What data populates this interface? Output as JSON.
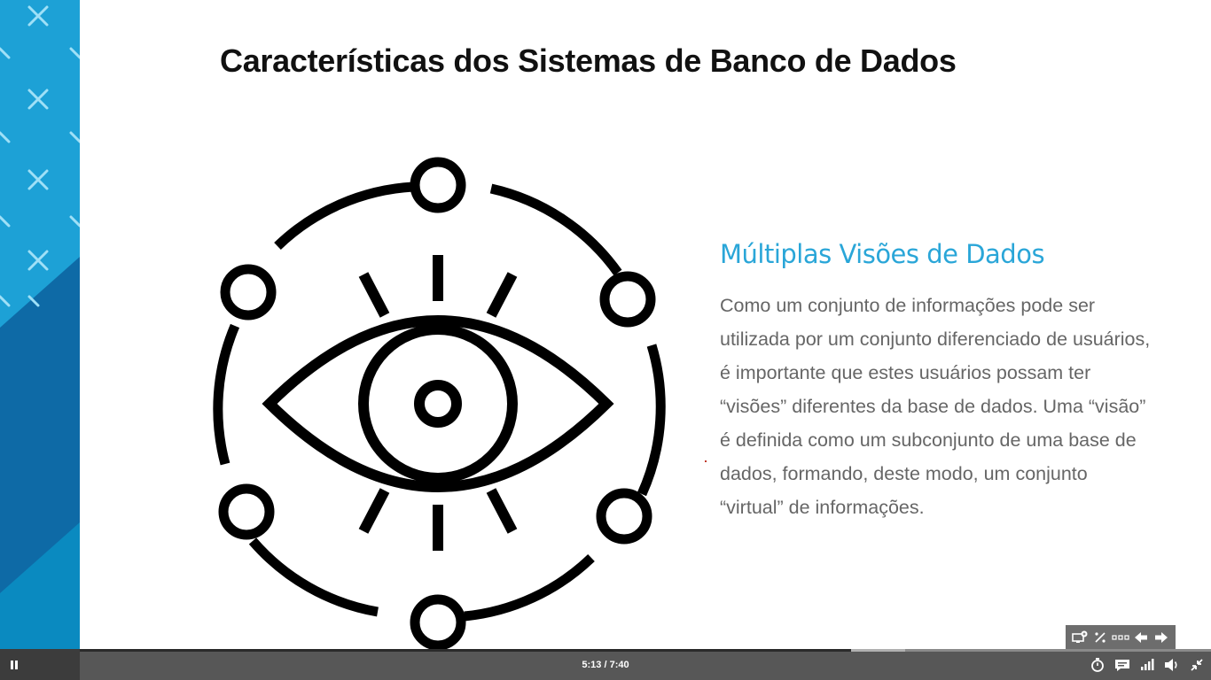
{
  "slide": {
    "title": "Características dos Sistemas de Banco de Dados",
    "section_heading": "Múltiplas Visões de Dados",
    "section_body": "Como um conjunto de informações pode ser utilizada por um conjunto diferenciado de usuários, é importante que estes usuários possam ter “visões” diferentes da base de dados. Uma “visão” é definida como um subconjunto de uma base de dados, formando, deste modo, um conjunto “virtual” de informações.",
    "graphic_icon": "eye-network-icon"
  },
  "overlay_toolbar": {
    "buttons": [
      {
        "name": "screen-capture-icon"
      },
      {
        "name": "percent-icon"
      },
      {
        "name": "more-dots-icon"
      },
      {
        "name": "previous-arrow-icon"
      },
      {
        "name": "next-arrow-icon"
      }
    ]
  },
  "player": {
    "time": "5:13 / 7:40",
    "progress_fraction": 0.682,
    "buffered_fraction": 0.73,
    "state": "playing",
    "controls": [
      "pause-icon",
      "timer-icon",
      "captions-icon",
      "quality-icon",
      "volume-icon",
      "exit-fullscreen-icon"
    ]
  },
  "colors": {
    "accent": "#2aa6d8",
    "deco_light": "#1da1d6",
    "deco_dark": "#0a5c8f",
    "player_bg": "#575757"
  }
}
